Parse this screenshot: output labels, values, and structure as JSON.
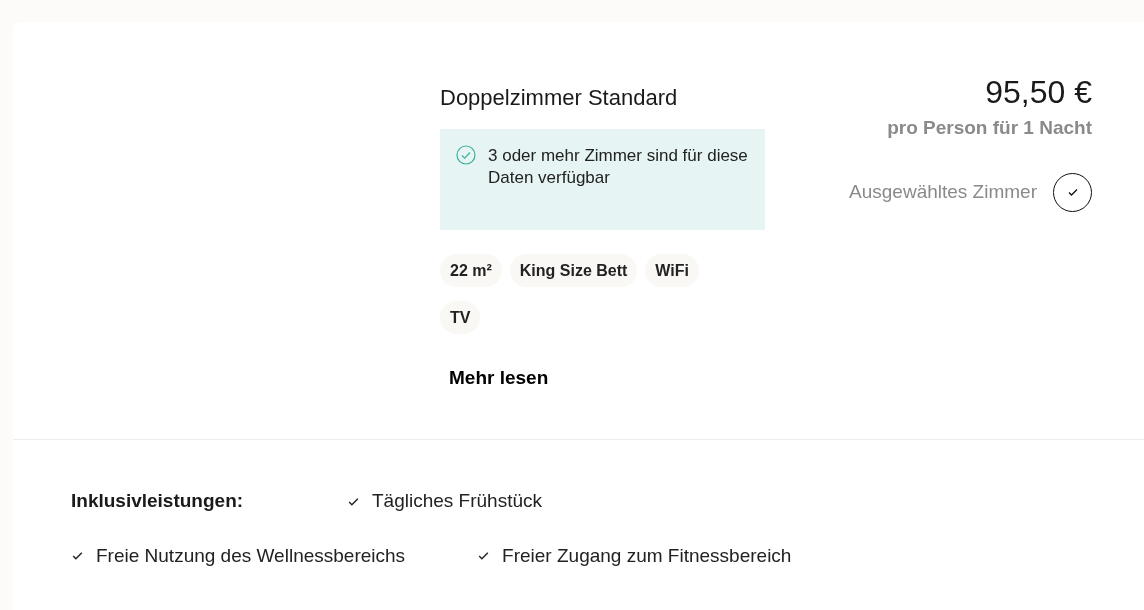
{
  "room": {
    "title": "Doppelzimmer Standard",
    "availability": "3 oder mehr Zimmer sind für diese Daten verfügbar",
    "features": [
      "22 m²",
      "King Size Bett",
      "WiFi",
      "TV"
    ],
    "more_link": "Mehr lesen",
    "price": "95,50 €",
    "price_note": "pro Person für 1 Nacht",
    "selection": {
      "label": "Ausgewähltes Zimmer",
      "selected": true
    }
  },
  "inclusions": {
    "label": "Inklusivleistungen:",
    "items": [
      "Tägliches Frühstück",
      "Freie Nutzung des Wellnessbereichs",
      "Freier Zugang zum Fitnessbereich"
    ]
  }
}
